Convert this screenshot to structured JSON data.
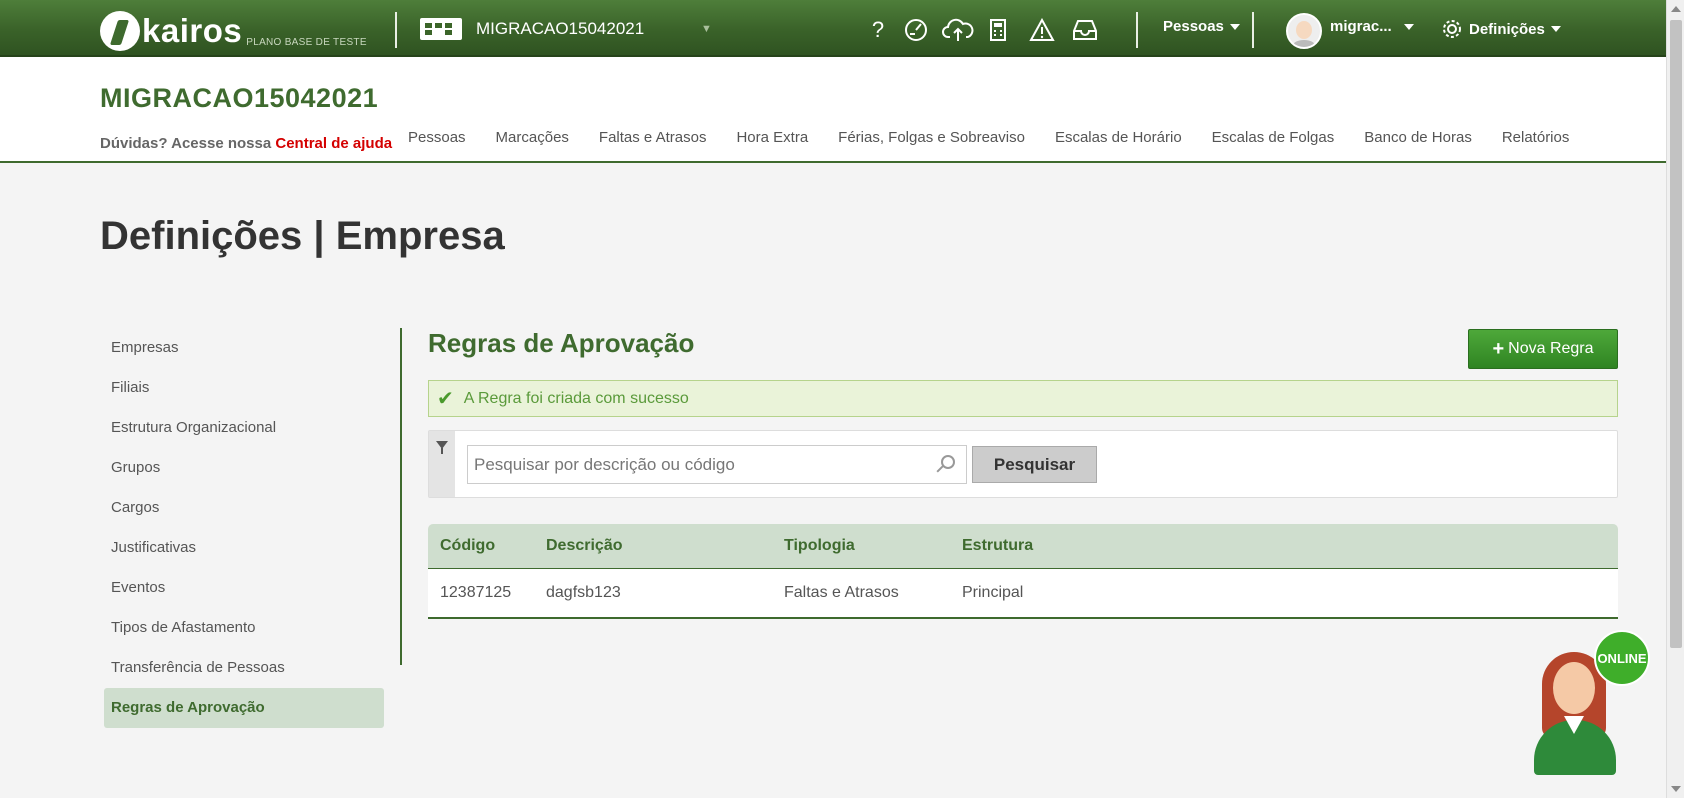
{
  "topbar": {
    "logo_text": "kairos",
    "logo_sub": "PLANO BASE DE TESTE",
    "company_selector": "MIGRACAO15042021",
    "menu_pessoas": "Pessoas",
    "user_name": "migrac...",
    "menu_definicoes": "Definições",
    "icons": [
      "help-icon",
      "speed-icon",
      "cloud-upload-icon",
      "calculator-icon",
      "warning-icon",
      "inbox-icon",
      "gear-icon"
    ]
  },
  "header": {
    "company_title": "MIGRACAO15042021",
    "help_prefix": "Dúvidas? Acesse nossa",
    "help_link": "Central de ajuda",
    "nav": [
      "Pessoas",
      "Marcações",
      "Faltas e Atrasos",
      "Hora Extra",
      "Férias, Folgas e Sobreaviso",
      "Escalas de Horário",
      "Escalas de Folgas",
      "Banco de Horas",
      "Relatórios"
    ]
  },
  "page": {
    "title": "Definições | Empresa"
  },
  "sidebar": {
    "items": [
      "Empresas",
      "Filiais",
      "Estrutura Organizacional",
      "Grupos",
      "Cargos",
      "Justificativas",
      "Eventos",
      "Tipos de Afastamento",
      "Transferência de Pessoas",
      "Regras de Aprovação"
    ],
    "active": "Regras de Aprovação"
  },
  "main": {
    "section_title": "Regras de Aprovação",
    "new_button": "Nova Regra",
    "alert_message": "A Regra foi criada com sucesso",
    "search_placeholder": "Pesquisar por descrição ou código",
    "search_button": "Pesquisar",
    "table": {
      "columns": [
        "Código",
        "Descrição",
        "Tipologia",
        "Estrutura"
      ],
      "rows": [
        [
          "12387125",
          "dagfsb123",
          "Faltas e Atrasos",
          "Principal"
        ]
      ]
    }
  },
  "chat": {
    "status": "ONLINE"
  },
  "colors": {
    "brand_green": "#3f6b2f",
    "active_bg": "#cfdece",
    "alert_bg": "#eaf3d9"
  }
}
